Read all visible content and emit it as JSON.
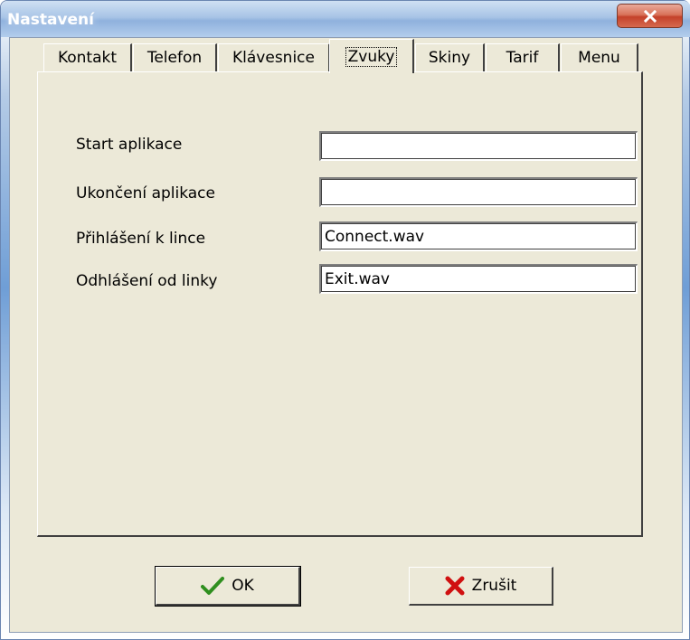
{
  "window": {
    "title": "Nastavení",
    "close_glyph": "x"
  },
  "tabs": [
    {
      "label": "Kontakt",
      "active": false
    },
    {
      "label": "Telefon",
      "active": false
    },
    {
      "label": "Klávesnice",
      "active": false
    },
    {
      "label": "Zvuky",
      "active": true
    },
    {
      "label": "Skiny",
      "active": false
    },
    {
      "label": "Tarif",
      "active": false
    },
    {
      "label": "Menu",
      "active": false
    }
  ],
  "fields": [
    {
      "label": "Start aplikace",
      "value": ""
    },
    {
      "label": "Ukončení aplikace",
      "value": ""
    },
    {
      "label": "Přihlášení k lince",
      "value": "Connect.wav"
    },
    {
      "label": "Odhlášení od linky",
      "value": "Exit.wav"
    }
  ],
  "buttons": {
    "ok_label": "OK",
    "ok_icon": "checkmark-icon",
    "cancel_label": "Zrušit",
    "cancel_icon": "red-x-icon"
  },
  "colors": {
    "dialog_face": "#ece9d8",
    "close_button": "#c4412a",
    "ok_icon": "#2f8f1f",
    "cancel_icon": "#d01010"
  }
}
